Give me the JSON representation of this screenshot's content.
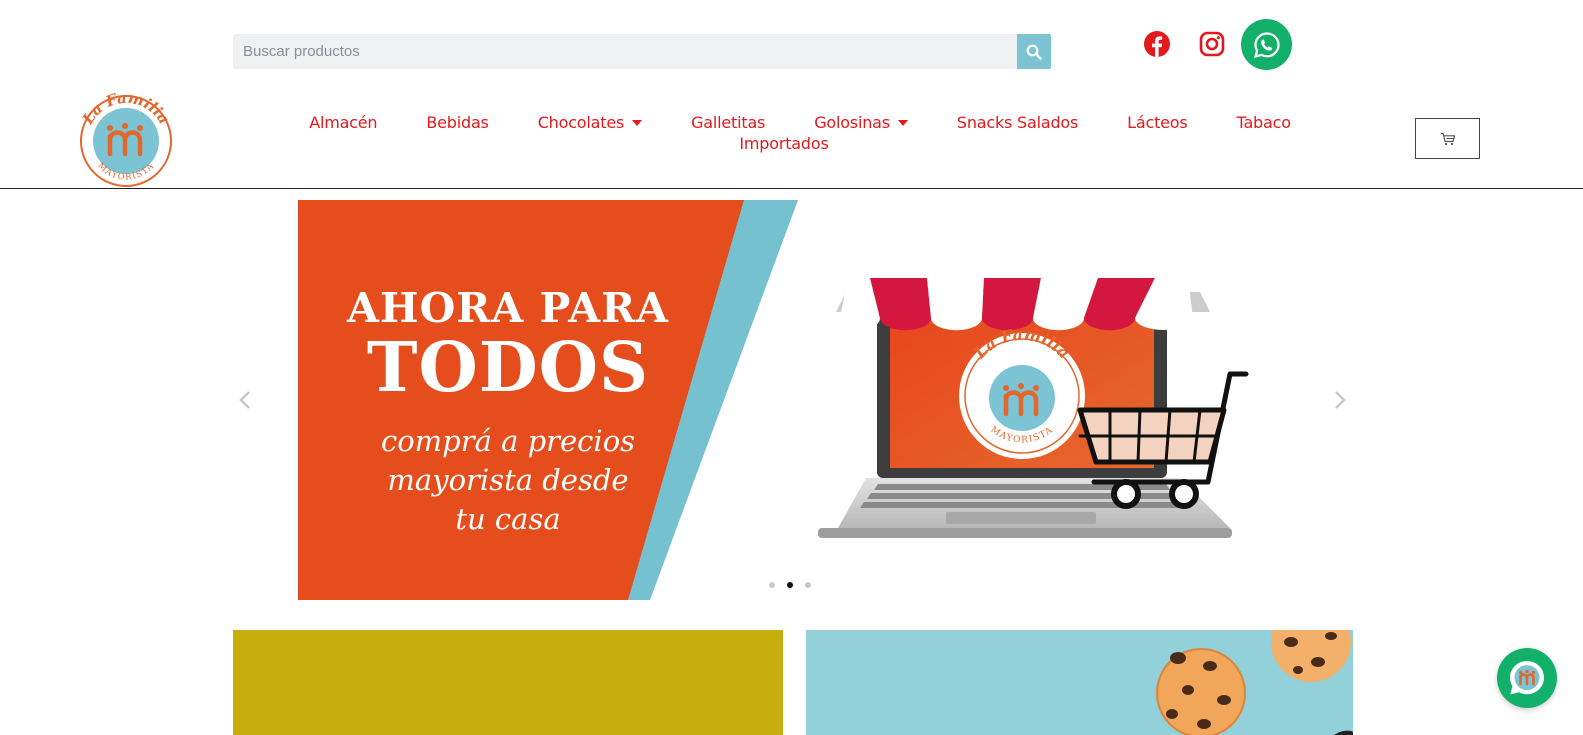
{
  "search": {
    "placeholder": "Buscar productos",
    "button_icon": "search-icon"
  },
  "social": {
    "facebook_icon": "facebook-icon",
    "instagram_icon": "instagram-icon",
    "whatsapp_icon": "whatsapp-icon"
  },
  "logo": {
    "top_text": "La Familia",
    "bottom_text": "MAYORISTA"
  },
  "nav": {
    "items": [
      {
        "label": "Almacén",
        "has_dropdown": false
      },
      {
        "label": "Bebidas",
        "has_dropdown": false
      },
      {
        "label": "Chocolates",
        "has_dropdown": true
      },
      {
        "label": "Galletitas",
        "has_dropdown": false
      },
      {
        "label": "Golosinas",
        "has_dropdown": true
      },
      {
        "label": "Snacks Salados",
        "has_dropdown": false
      },
      {
        "label": "Lácteos",
        "has_dropdown": false
      },
      {
        "label": "Tabaco",
        "has_dropdown": false
      },
      {
        "label": "Importados",
        "has_dropdown": false
      }
    ]
  },
  "cart": {
    "icon": "cart-icon"
  },
  "slider": {
    "heading_1": "AHORA PARA",
    "heading_2": "TODOS",
    "subtitle_lines": [
      "comprá a precios",
      "mayorista desde",
      "tu casa"
    ],
    "logo_top_text": "La Familia",
    "logo_bottom_text": "MAYORISTA",
    "active_slide": 2,
    "total_slides": 3
  },
  "colors": {
    "brand_red": "#e4191c",
    "slide_orange": "#e64d1c",
    "accent_blue": "#7cc3d3",
    "whatsapp_green": "#13b06b",
    "banner_yellow": "#c7ae0c",
    "banner_blue": "#92d0da"
  }
}
